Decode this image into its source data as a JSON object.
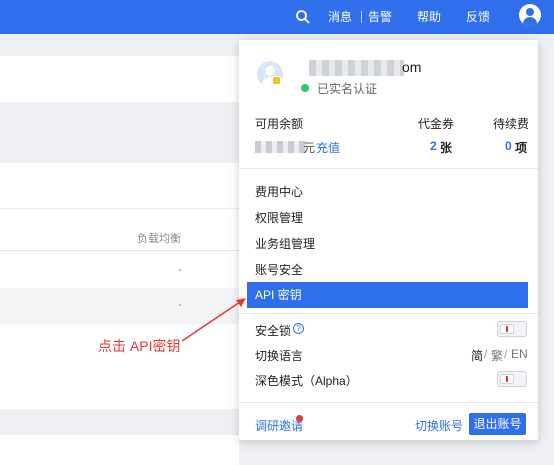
{
  "topbar": {
    "bg_color": "#2f6fec",
    "search_icon": "search-icon",
    "messages": "消息",
    "alerts": "告警",
    "help": "帮助",
    "feedback": "反馈",
    "user_icon": "user-icon"
  },
  "background": {
    "column_header": "负载均衡",
    "cell_1": "-",
    "cell_2": "-"
  },
  "account": {
    "email_visible": "om",
    "verify_status": "已实名认证"
  },
  "balance": {
    "available_label": "可用余额",
    "voucher_label": "代金券",
    "renewal_label": "待续费",
    "currency_suffix": "元",
    "recharge_link": "充值",
    "voucher_count": "2",
    "voucher_unit": "张",
    "renewal_count": "0",
    "renewal_unit": "项"
  },
  "menu": {
    "items": [
      {
        "label": "费用中心"
      },
      {
        "label": "权限管理"
      },
      {
        "label": "业务组管理"
      },
      {
        "label": "账号安全"
      },
      {
        "label": "API 密钥"
      }
    ]
  },
  "settings": {
    "security_lock": "安全锁",
    "switch_language": "切换语言",
    "lang_simplified": "简",
    "lang_traditional": "繁",
    "lang_english": "EN",
    "lang_sep": "/",
    "dark_mode": "深色模式（Alpha）"
  },
  "footer": {
    "survey": "调研邀请",
    "switch_account": "切换账号",
    "logout": "退出账号"
  },
  "annotation": {
    "text": "点击 API密钥",
    "color": "#e53935"
  }
}
